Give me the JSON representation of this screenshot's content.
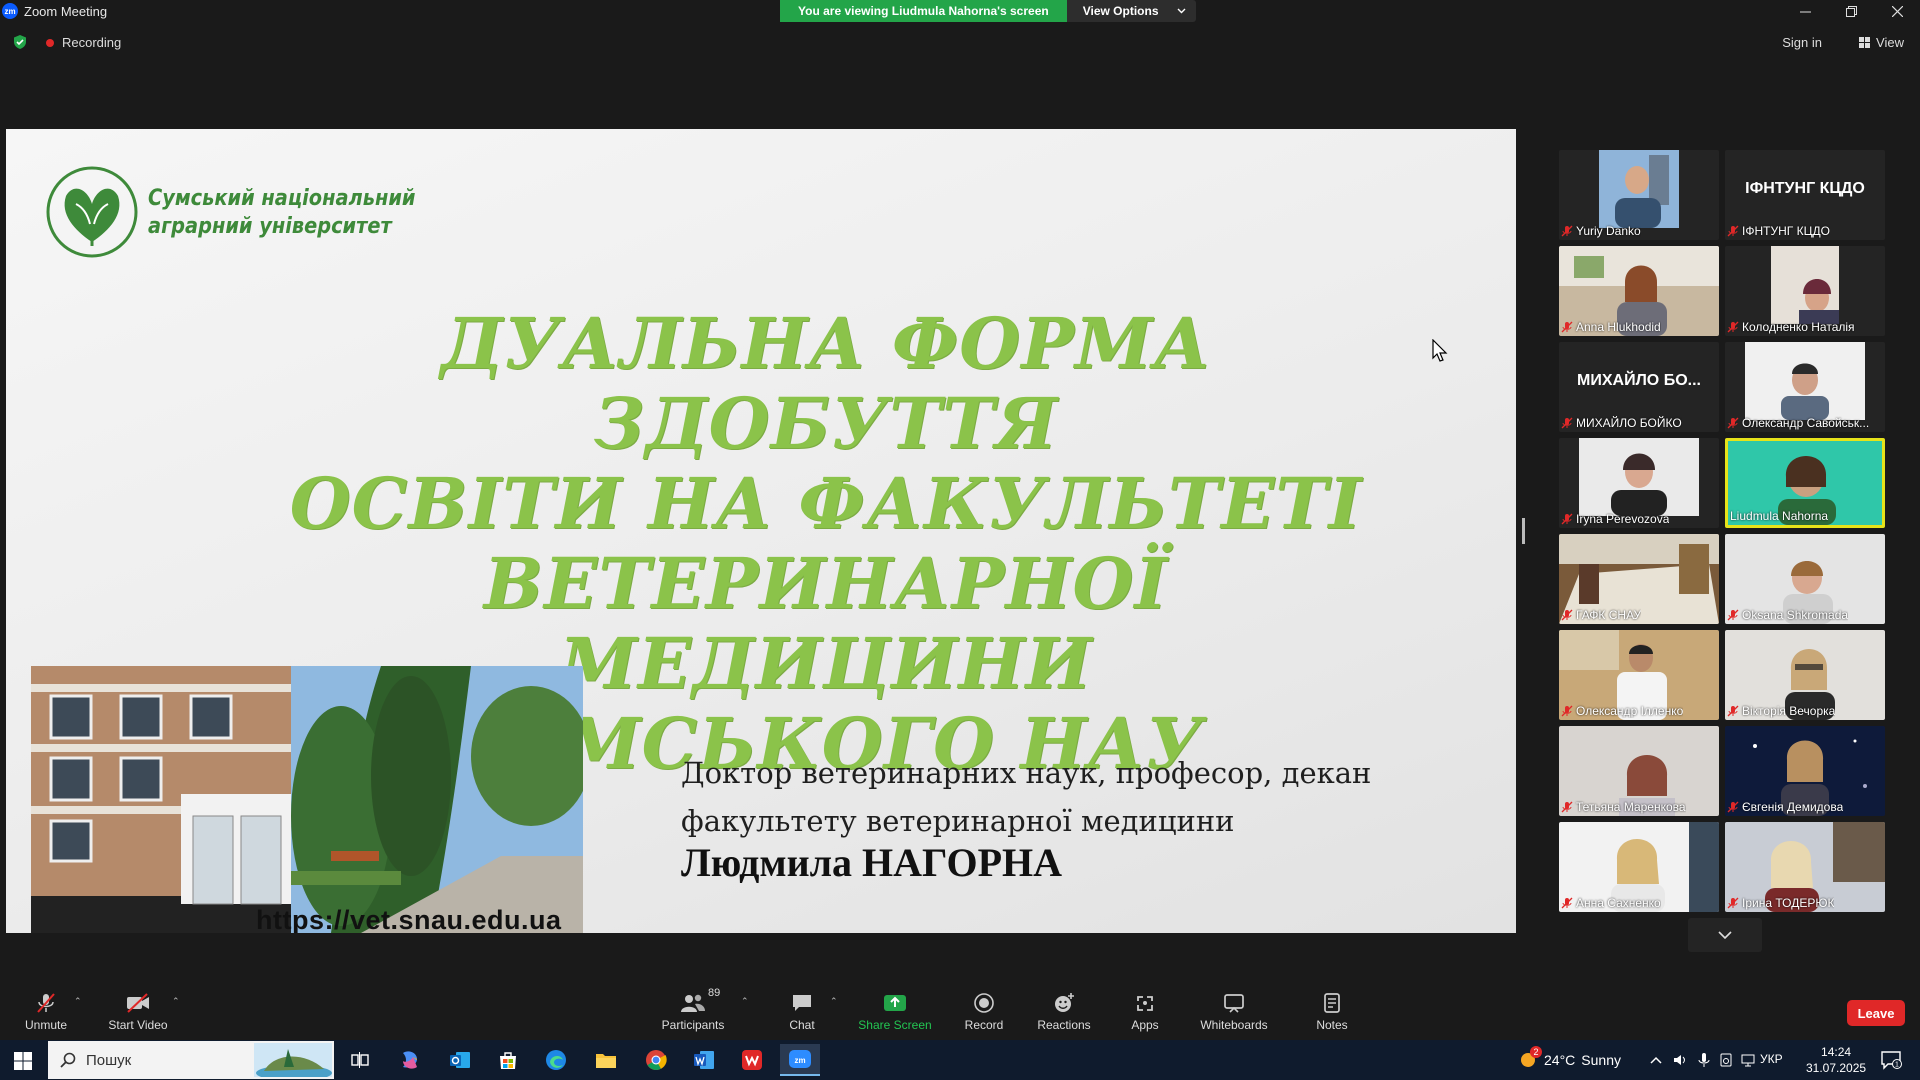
{
  "window": {
    "title": "Zoom Meeting",
    "app_logo_text": "zm",
    "controls": [
      "minimize-icon",
      "restore-icon",
      "close-icon"
    ]
  },
  "banner": {
    "viewing_text": "You are viewing Liudmula Nahorna's screen",
    "view_options_label": "View Options"
  },
  "status": {
    "recording_label": "Recording",
    "sign_in_label": "Sign in",
    "view_label": "View",
    "accent_green": "#23a549",
    "record_red": "#e02828"
  },
  "slide": {
    "university_name_line1": "Сумський національний",
    "university_name_line2": "аграрний університет",
    "title_line1": "ДУАЛЬНА ФОРМА ЗДОБУТТЯ",
    "title_line2": "ОСВІТИ НА ФАКУЛЬТЕТІ",
    "title_line3": "ВЕТЕРИНАРНОЇ МЕДИЦИНИ",
    "title_line4": "СУМСЬКОГО НАУ",
    "subtitle_line1": "Доктор ветеринарних наук, професор, декан",
    "subtitle_line2": "факультету ветеринарної медицини",
    "presenter": "Людмила НАГОРНА",
    "url": "https://vet.snau.edu.ua",
    "title_color": "#8bc34a",
    "logo_color": "#3e8a3a"
  },
  "participants": [
    {
      "name": "Yuriy Danko",
      "video": true,
      "muted": true
    },
    {
      "name": "ІФНТУНГ КЦДО",
      "video": false,
      "display": "ІФНТУНГ КЦДО",
      "muted": true
    },
    {
      "name": "Anna Hlukhodid",
      "video": true,
      "muted": true
    },
    {
      "name": "Колодненко Наталія",
      "video": true,
      "muted": true
    },
    {
      "name": "МИХАЙЛО БОЙКО",
      "video": false,
      "display": "МИХАЙЛО БО...",
      "muted": true
    },
    {
      "name": "Олександр Савойськ...",
      "video": true,
      "muted": true
    },
    {
      "name": "Iryna Perevozova",
      "video": true,
      "muted": true
    },
    {
      "name": "Liudmula Nahorna",
      "video": true,
      "muted": false,
      "active_speaker": true
    },
    {
      "name": "ГАФК СНАУ",
      "video": true,
      "muted": true
    },
    {
      "name": "Oksana Shkromada",
      "video": true,
      "muted": true
    },
    {
      "name": "Олександр Ілленко",
      "video": true,
      "muted": true
    },
    {
      "name": "Вікторія Вечорка",
      "video": true,
      "muted": true
    },
    {
      "name": "Тетьяна Маренкова",
      "video": true,
      "muted": true
    },
    {
      "name": "Євгенія Демидова",
      "video": true,
      "muted": true
    },
    {
      "name": "Анна Сахненко",
      "video": true,
      "muted": true
    },
    {
      "name": "Ірина ТОДЕРЮК",
      "video": true,
      "muted": true
    }
  ],
  "toolbar": {
    "unmute_label": "Unmute",
    "start_video_label": "Start Video",
    "participants_label": "Participants",
    "participants_count": "89",
    "chat_label": "Chat",
    "share_screen_label": "Share Screen",
    "record_label": "Record",
    "reactions_label": "Reactions",
    "apps_label": "Apps",
    "whiteboards_label": "Whiteboards",
    "notes_label": "Notes",
    "leave_label": "Leave"
  },
  "taskbar": {
    "search_placeholder": "Пошук",
    "apps": [
      "task-view-icon",
      "copilot-icon",
      "outlook-icon",
      "store-icon",
      "edge-icon",
      "file-explorer-icon",
      "chrome-icon",
      "word-icon",
      "wps-icon",
      "zoom-icon"
    ],
    "weather_temp": "24°C",
    "weather_desc": "Sunny",
    "weather_badge": "2",
    "language": "УКР",
    "time": "14:24",
    "date": "31.07.2025",
    "notification_count": "1"
  }
}
